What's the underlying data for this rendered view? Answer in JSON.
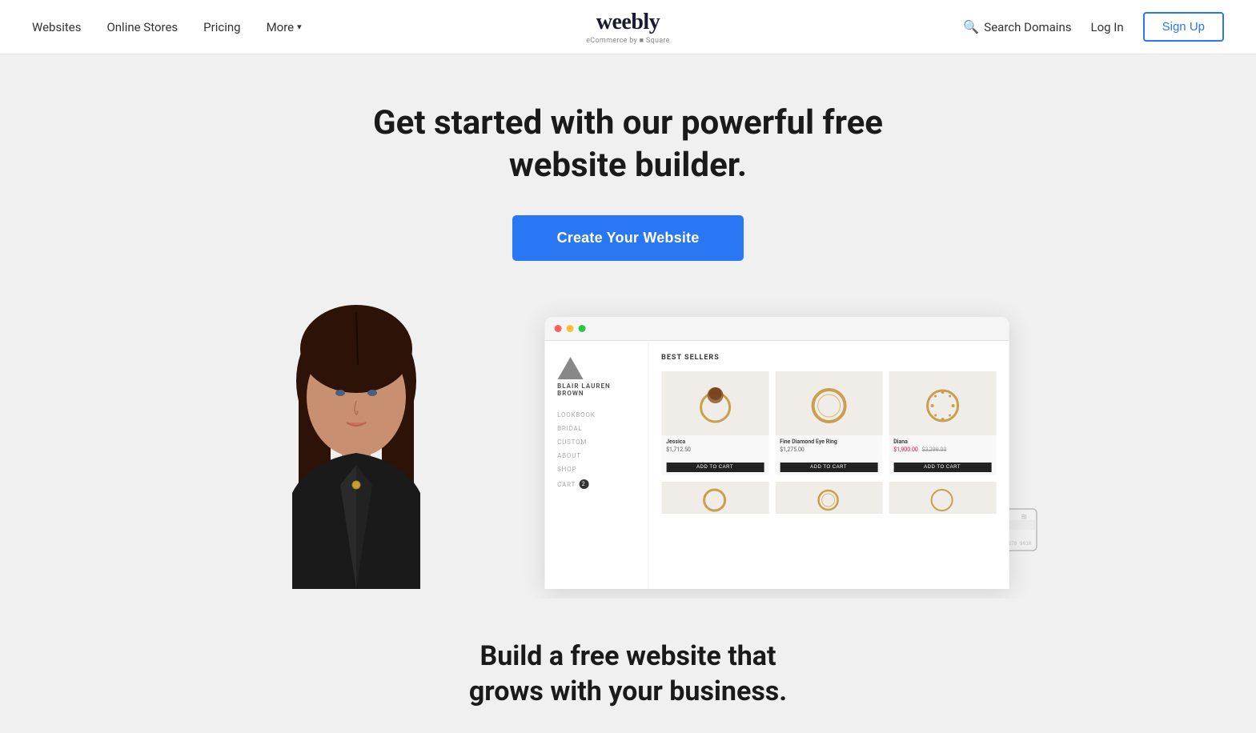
{
  "brand": {
    "logo_text": "weebly",
    "logo_sub": "eCommerce by ■ Square"
  },
  "nav": {
    "items": [
      {
        "label": "Websites",
        "href": "#"
      },
      {
        "label": "Online Stores",
        "href": "#"
      },
      {
        "label": "Pricing",
        "href": "#"
      },
      {
        "label": "More",
        "href": "#"
      }
    ],
    "more_chevron": "▾",
    "search_domains_label": "Search Domains",
    "login_label": "Log In",
    "signup_label": "Sign Up"
  },
  "hero": {
    "headline_line1": "Get started with our powerful free",
    "headline_line2": "website builder.",
    "cta_label": "Create Your Website"
  },
  "browser_mockup": {
    "section_title": "BEST SELLERS",
    "sidebar_brand": "BLAIR LAUREN BROWN",
    "sidebar_nav": [
      "LOOKBOOK",
      "BRIDAL",
      "CUSTOM",
      "ABOUT",
      "SHOP",
      "CART"
    ],
    "cart_count": "2",
    "products": [
      {
        "name": "Jessica",
        "price": "$1,712.50",
        "emoji": "💍"
      },
      {
        "name": "Fine Diamond Eye Ring",
        "price": "$1,275.00",
        "emoji": "💍"
      },
      {
        "name": "Diana",
        "price_sale": "$1,900.00",
        "price_original": "$3,299.00",
        "emoji": "💍"
      }
    ]
  },
  "subheadline": {
    "line1": "Build a free website that",
    "line2": "grows with your business."
  },
  "colors": {
    "accent_blue": "#2977f5",
    "background": "#f0f0f0",
    "nav_bg": "#ffffff"
  }
}
